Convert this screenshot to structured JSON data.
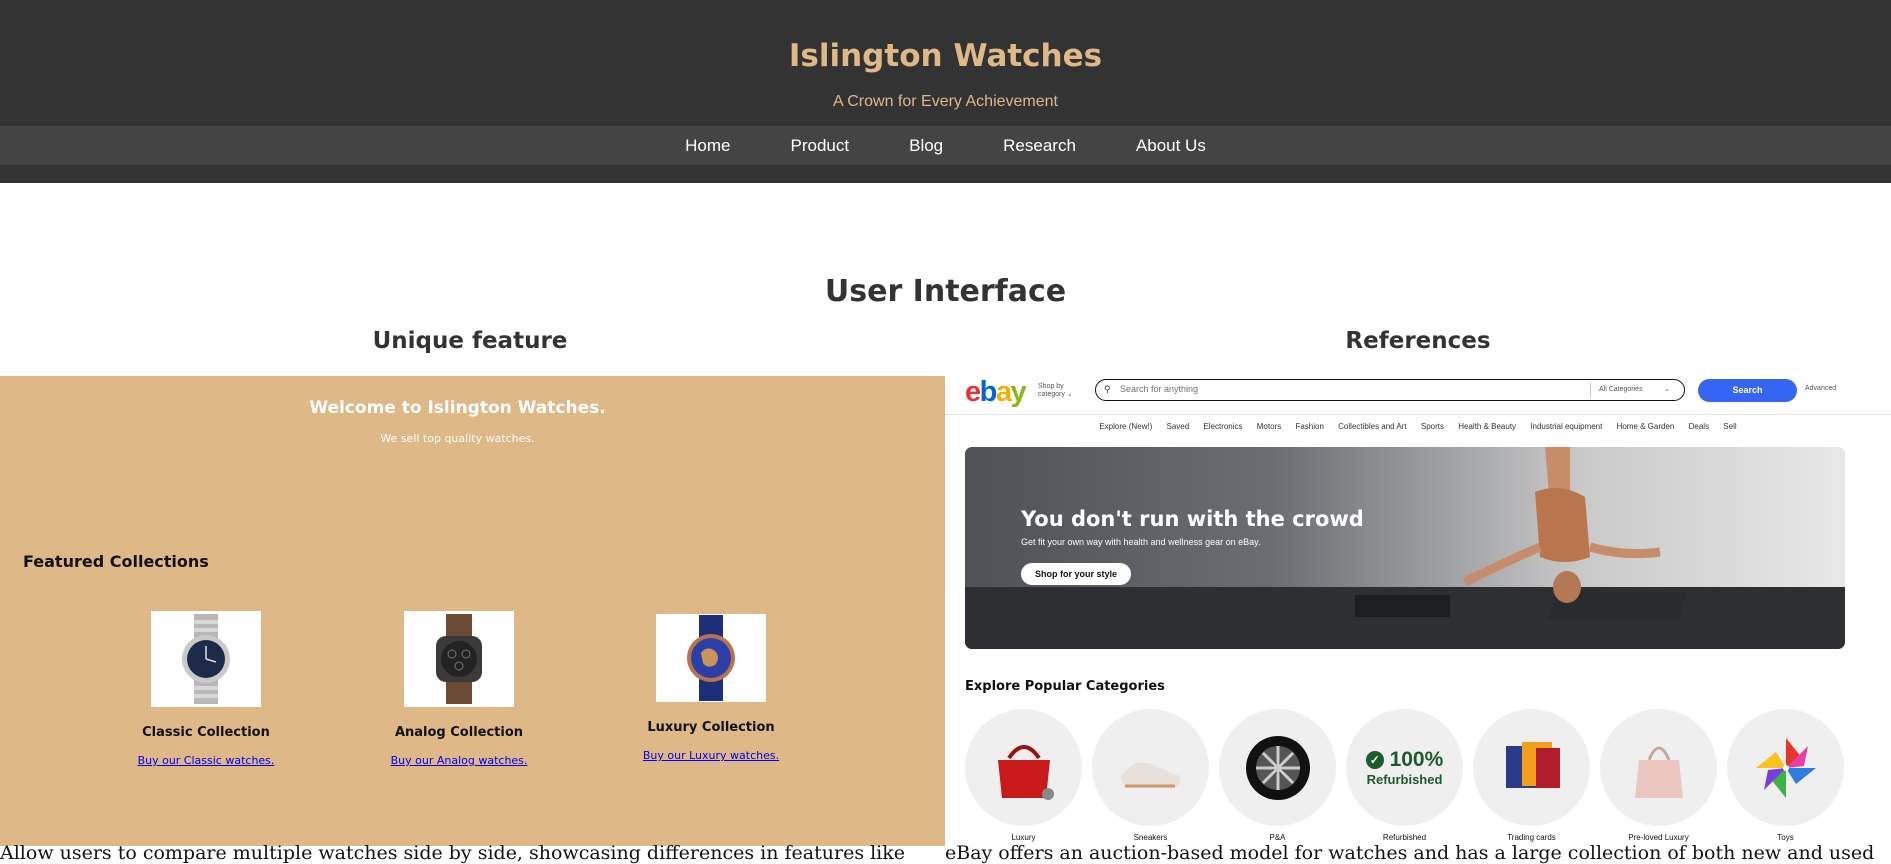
{
  "header": {
    "title": "Islington Watches",
    "tagline": "A Crown for Every Achievement",
    "nav": [
      "Home",
      "Product",
      "Blog",
      "Research",
      "About Us"
    ]
  },
  "section": {
    "title": "User Interface",
    "left_title": "Unique feature",
    "right_title": "References"
  },
  "left_panel": {
    "welcome": "Welcome to Islington Watches.",
    "welcome_sub": "We sell top quality watches.",
    "featured": "Featured Collections",
    "cards": [
      {
        "name": "Classic Collection",
        "link": "Buy our Classic watches."
      },
      {
        "name": "Analog Collection",
        "link": "Buy our Analog watches."
      },
      {
        "name": "Luxury Collection",
        "link": "Buy our Luxury watches."
      }
    ]
  },
  "right_panel": {
    "logo_letters": [
      "e",
      "b",
      "a",
      "y"
    ],
    "shop_by": "Shop by category",
    "search_placeholder": "Search for anything",
    "category_select": "All Categories",
    "search_button": "Search",
    "advanced": "Advanced",
    "nav": [
      "Explore (New!)",
      "Saved",
      "Electronics",
      "Motors",
      "Fashion",
      "Collectibles and Art",
      "Sports",
      "Health & Beauty",
      "Industrial equipment",
      "Home & Garden",
      "Deals",
      "Sell"
    ],
    "hero_title": "You don't run with the crowd",
    "hero_sub": "Get fit your own way with health and wellness gear on eBay.",
    "hero_button": "Shop for your style",
    "explore_title": "Explore Popular Categories",
    "categories": [
      "Luxury",
      "Sneakers",
      "P&A",
      "Refurbished",
      "Trading cards",
      "Pre-loved Luxury",
      "Toys"
    ],
    "refurbished_badge": "100%",
    "refurbished_word": "Refurbished"
  },
  "bottom": {
    "left_text": "Allow users to compare multiple watches side by side, showcasing differences in features like",
    "right_text": "eBay offers an auction-based model for watches and has a large collection of both new and used"
  },
  "colors": {
    "header_bg": "#333333",
    "nav_bg": "#444444",
    "accent": "#deb887",
    "ebay_blue": "#3665f3"
  }
}
